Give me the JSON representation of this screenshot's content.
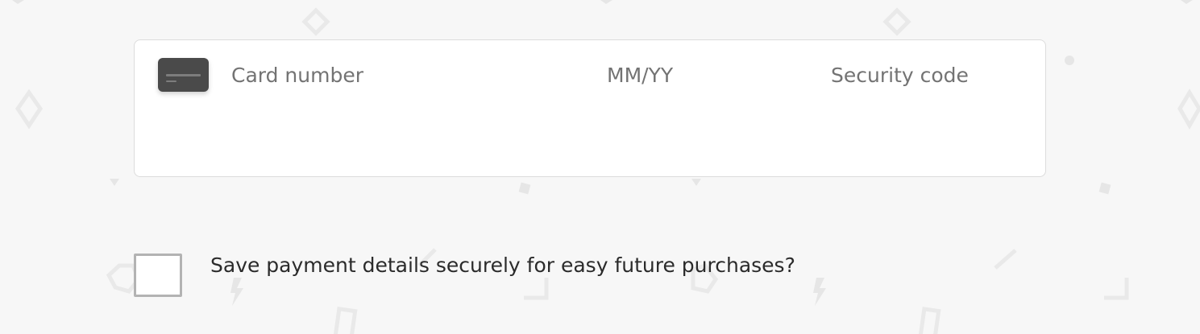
{
  "payment_form": {
    "card_number_placeholder": "Card number",
    "expiry_placeholder": "MM/YY",
    "security_code_placeholder": "Security code",
    "card_icon": "credit-card-icon"
  },
  "save_option": {
    "label": "Save payment details securely for easy future purchases?",
    "checked": false
  },
  "colors": {
    "background": "#f7f7f7",
    "card_box": "#ffffff",
    "card_icon": "#4a4a4a",
    "placeholder_text": "#737373",
    "label_text": "#2b2b2b",
    "checkbox_border": "#b3b3b3"
  }
}
